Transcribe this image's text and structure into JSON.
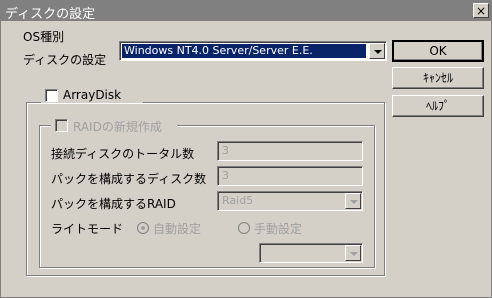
{
  "window": {
    "title": "ディスクの設定",
    "close_glyph": "×"
  },
  "os_type": {
    "label": "OS種別",
    "value": "Windows NT4.0 Server/Server E.E."
  },
  "disk_settings_label": "ディスクの設定",
  "arraydisk": {
    "label": "ArrayDisk",
    "checked": false
  },
  "raid_new": {
    "label": "RAIDの新規作成",
    "checked": false,
    "enabled": false
  },
  "fields": {
    "total_disks": {
      "label": "接続ディスクのトータル数",
      "value": "3"
    },
    "pack_disks": {
      "label": "パックを構成するディスク数",
      "value": "3"
    },
    "pack_raid": {
      "label": "パックを構成するRAID",
      "value": "Raid5"
    }
  },
  "write_mode": {
    "label": "ライトモード",
    "options": [
      {
        "label": "自動設定",
        "selected": true
      },
      {
        "label": "手動設定",
        "selected": false
      }
    ],
    "manual_value": ""
  },
  "buttons": {
    "ok": "OK",
    "cancel": "ｷｬﾝｾﾙ",
    "help": "ﾍﾙﾌﾟ"
  }
}
